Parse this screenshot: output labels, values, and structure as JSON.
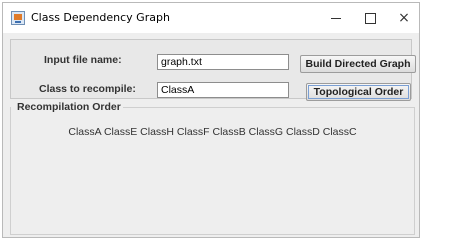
{
  "window": {
    "title": "Class Dependency Graph",
    "controls": {
      "minimize": "minimize",
      "maximize": "maximize",
      "close": "×"
    }
  },
  "form": {
    "input_file_label": "Input file name:",
    "input_file_value": "graph.txt",
    "class_label": "Class to recompile:",
    "class_value": "ClassA",
    "build_button": "Build Directed Graph",
    "topo_button": "Topological Order"
  },
  "output": {
    "section_title": "Recompilation Order",
    "order_text": "ClassA ClassE ClassH ClassF ClassB ClassG ClassD ClassC"
  },
  "icons": {
    "app": "java-app-icon",
    "minimize": "minimize-icon",
    "maximize": "maximize-icon",
    "close": "close-icon"
  },
  "colors": {
    "window_bg": "#eeeeee",
    "titlebar_bg": "#ffffff",
    "panel_border": "#c8c8c8",
    "button_border": "#9c9c9c"
  }
}
